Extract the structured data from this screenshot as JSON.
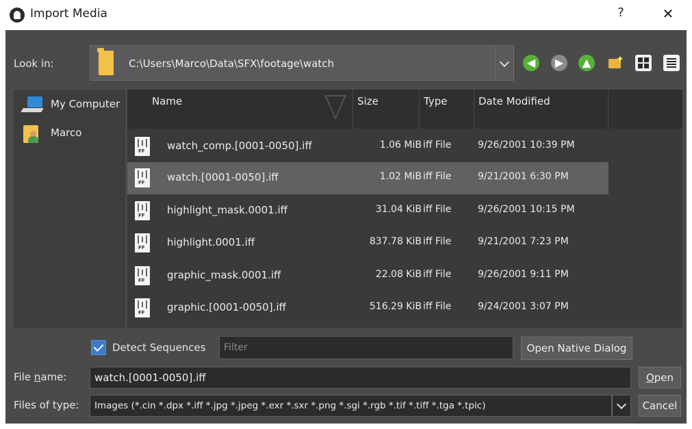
{
  "window": {
    "title": "Import Media",
    "help_label": "?",
    "close_label": "✕"
  },
  "lookin": {
    "label": "Look in:",
    "path": "C:\\Users\\Marco\\Data\\SFX\\footage\\watch"
  },
  "toolbar": {
    "back_glyph": "◀",
    "forward_glyph": "▶",
    "up_glyph": "▲",
    "icons": [
      "back-icon",
      "forward-icon",
      "up-icon",
      "new-folder-icon",
      "grid-view-icon",
      "list-view-icon"
    ],
    "colors": {
      "back": "#57b03a",
      "forward": "#8a8a8a",
      "up": "#57b03a"
    }
  },
  "sidebar": {
    "items": [
      {
        "label": "My Computer",
        "icon": "computer-icon"
      },
      {
        "label": "Marco",
        "icon": "user-folder-icon"
      }
    ]
  },
  "filelist": {
    "columns": [
      "Name",
      "Size",
      "Type",
      "Date Modified"
    ],
    "selected_index": 1,
    "rows": [
      {
        "name": "watch_comp.[0001-0050].iff",
        "size": "1.06 MiB",
        "type": "iff File",
        "date": "9/26/2001 10:39 PM"
      },
      {
        "name": "watch.[0001-0050].iff",
        "size": "1.02 MiB",
        "type": "iff File",
        "date": "9/21/2001 6:30 PM"
      },
      {
        "name": "highlight_mask.0001.iff",
        "size": "31.04 KiB",
        "type": "iff File",
        "date": "9/26/2001 10:15 PM"
      },
      {
        "name": "highlight.0001.iff",
        "size": "837.78 KiB",
        "type": "iff File",
        "date": "9/21/2001 7:23 PM"
      },
      {
        "name": "graphic_mask.0001.iff",
        "size": "22.08 KiB",
        "type": "iff File",
        "date": "9/26/2001 9:11 PM"
      },
      {
        "name": "graphic.[0001-0050].iff",
        "size": "516.29 KiB",
        "type": "iff File",
        "date": "9/24/2001 3:07 PM"
      }
    ],
    "file_icon_label": "FF"
  },
  "options": {
    "detect_sequences_label": "Detect Sequences",
    "detect_sequences_checked": true,
    "filter_placeholder": "Filter",
    "open_native_label": "Open Native Dialog"
  },
  "filename": {
    "label_prefix": "File ",
    "label_underlined": "n",
    "label_suffix": "ame:",
    "value": "watch.[0001-0050].iff"
  },
  "filetype": {
    "label": "Files of type:",
    "value": "Images (*.cin *.dpx *.iff *.jpg *.jpeg *.exr *.sxr *.png *.sgi *.rgb *.tif *.tiff *.tga *.tpic)"
  },
  "buttons": {
    "open_underlined": "O",
    "open_rest": "pen",
    "cancel": "Cancel"
  },
  "colors": {
    "dialog_bg": "#4a4a4a",
    "selection": "#616161",
    "checkbox": "#3d7cc8"
  }
}
